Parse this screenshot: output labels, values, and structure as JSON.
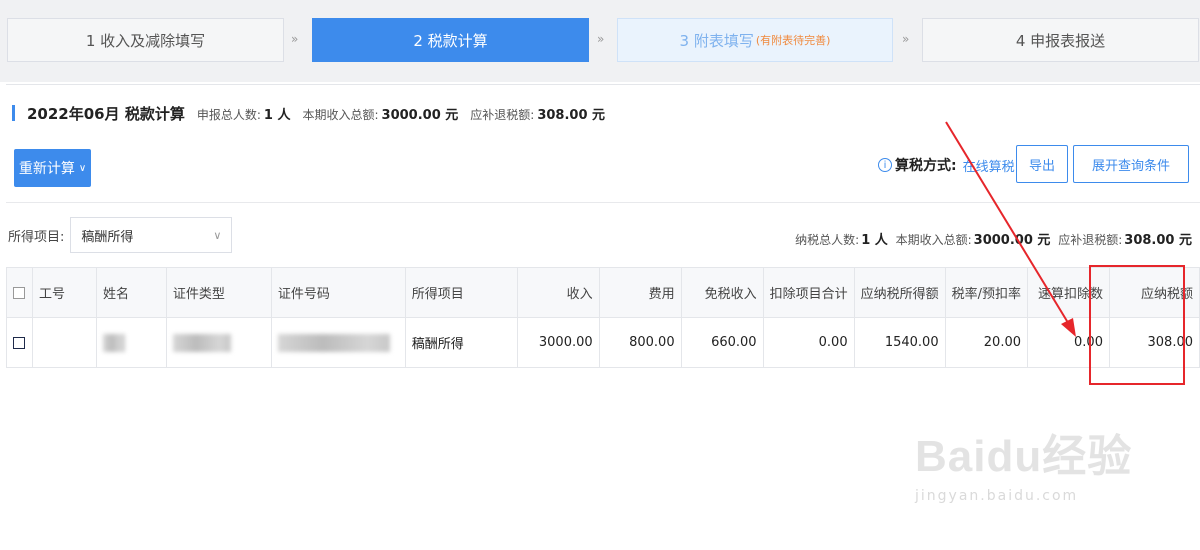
{
  "steps": [
    {
      "label": "1 收入及减除填写",
      "note": ""
    },
    {
      "label": "2 税款计算",
      "note": ""
    },
    {
      "label": "3 附表填写",
      "note": "(有附表待完善)"
    },
    {
      "label": "4 申报表报送",
      "note": ""
    }
  ],
  "step_separator": "»",
  "header": {
    "title": "2022年06月 税款计算",
    "declare_count_label": "申报总人数:",
    "declare_count_value": "1 人",
    "income_total_label": "本期收入总额:",
    "income_total_value": "3000.00 元",
    "tax_due_label": "应补退税额:",
    "tax_due_value": "308.00 元"
  },
  "toolbar": {
    "recalc_label": "重新计算",
    "method_label": "算税方式:",
    "method_value": "在线算税",
    "export_label": "导出",
    "expand_label": "展开查询条件"
  },
  "filter": {
    "label": "所得项目:",
    "selected": "稿酬所得"
  },
  "summary": {
    "taxpayers_label": "纳税总人数:",
    "taxpayers_value": "1 人",
    "income_label": "本期收入总额:",
    "income_value": "3000.00 元",
    "refund_label": "应补退税额:",
    "refund_value": "308.00 元"
  },
  "table": {
    "headers": [
      "工号",
      "姓名",
      "证件类型",
      "证件号码",
      "所得项目",
      "收入",
      "费用",
      "免税收入",
      "扣除项目合计",
      "应纳税所得额",
      "税率/预扣率",
      "速算扣除数",
      "应纳税额"
    ],
    "rows": [
      {
        "employee_id": "",
        "name": "",
        "id_type": "",
        "id_number": "",
        "income_item": "稿酬所得",
        "income": "3000.00",
        "expense": "800.00",
        "tax_free_income": "660.00",
        "deductions_total": "0.00",
        "taxable_income": "1540.00",
        "tax_rate": "20.00",
        "quick_deduction": "0.00",
        "tax_payable": "308.00"
      }
    ]
  },
  "watermark": {
    "logo": "Baidu经验",
    "url": "jingyan.baidu.com"
  },
  "colors": {
    "accent": "#3d8bec",
    "annotation": "#e6262b"
  }
}
